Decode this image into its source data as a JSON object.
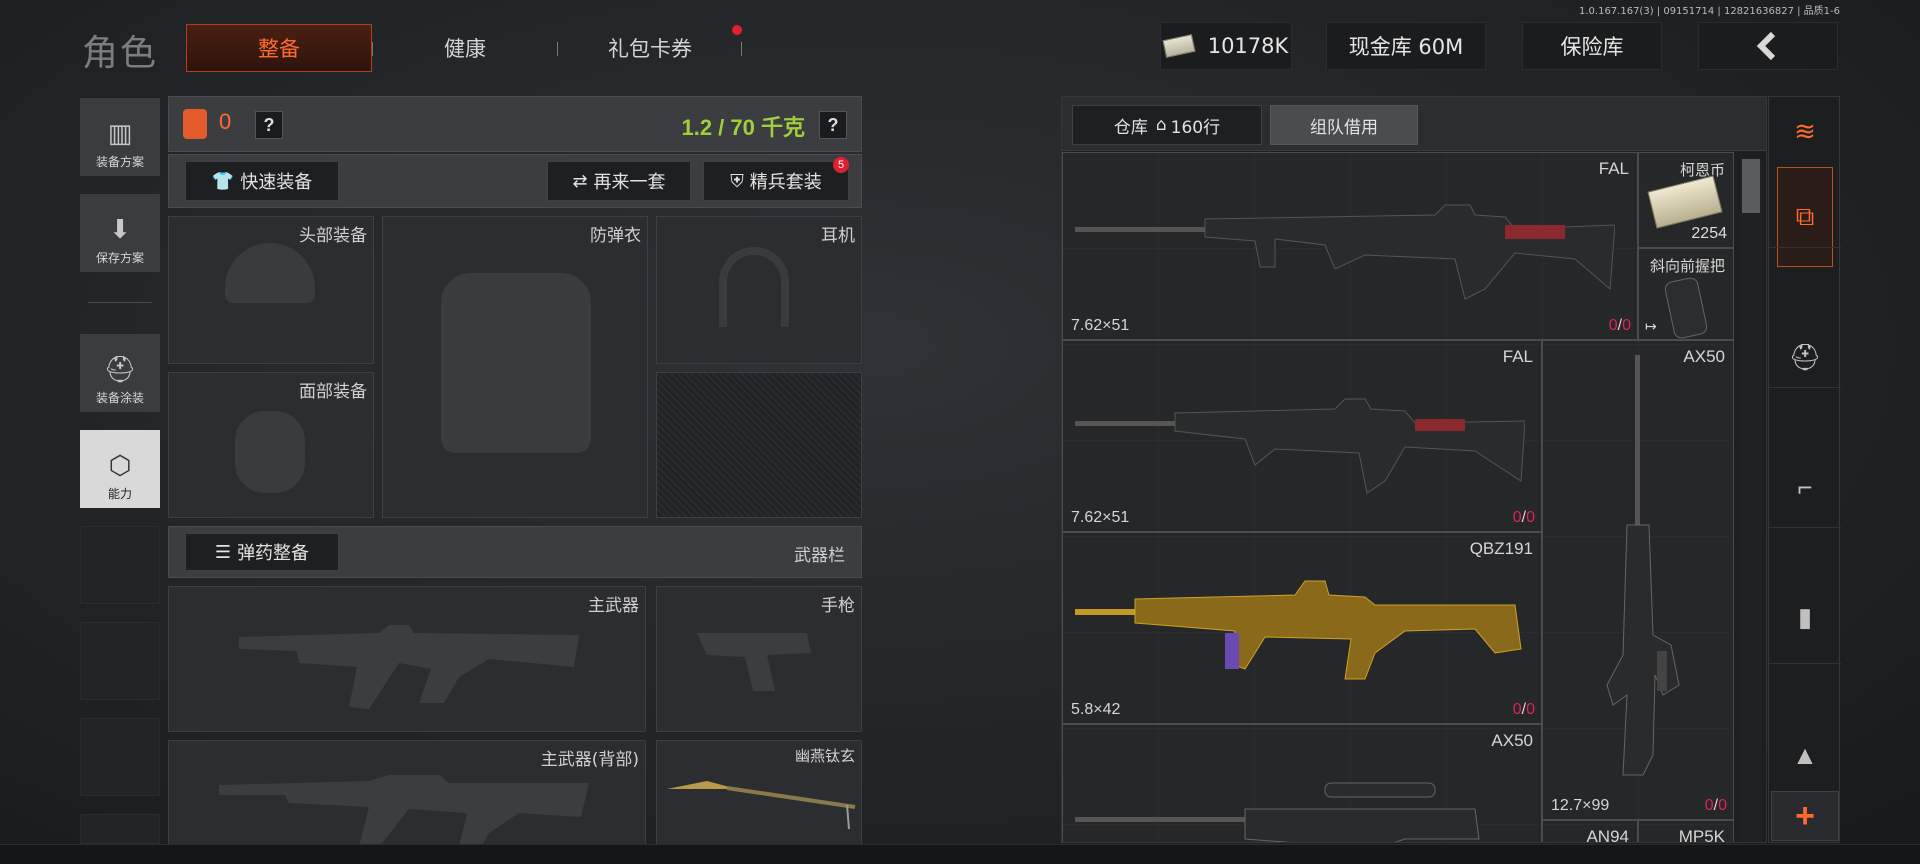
{
  "version": "1.0.167.167(3) | 09151714 | 12821636827 | 品质1-6",
  "nav": {
    "title": "角色",
    "tabs": [
      {
        "label": "整备",
        "active": true
      },
      {
        "label": "健康",
        "active": false
      },
      {
        "label": "礼包卡券",
        "active": false,
        "has_dot": true
      }
    ]
  },
  "topbar": {
    "money": "10178K",
    "cash_vault": "现金库 60M",
    "safe": "保险库",
    "back_icon": "chevron-left-icon"
  },
  "sidebar": [
    {
      "label": "装备方案",
      "icon": "vest-icon"
    },
    {
      "label": "保存方案",
      "icon": "download-icon"
    },
    {
      "label": "装备涂装",
      "icon": "helmet-icon"
    },
    {
      "label": "能力",
      "icon": "lightning-hex-icon",
      "selected": true
    }
  ],
  "loadout": {
    "armor_count": "0",
    "weight": "1.2 / 70 千克",
    "quick_equip": "快速装备",
    "another_set": "再来一套",
    "elite_set": "精兵套装",
    "elite_badge": "5",
    "slots": {
      "head": "头部装备",
      "vest": "防弹衣",
      "earphone": "耳机",
      "face": "面部装备"
    },
    "ammo_equip": "弹药整备",
    "weapon_bar": "武器栏",
    "weapons": {
      "primary": "主武器",
      "pistol": "手枪",
      "primary_back": "主武器(背部)",
      "melee": "幽燕钛玄"
    }
  },
  "warehouse": {
    "tab_label": "仓库",
    "tab_rows": "160行",
    "tab_team": "组队借用",
    "items": [
      {
        "name": "FAL",
        "caliber": "7.62×51",
        "dur_a": "0",
        "dur_b": "0"
      },
      {
        "name": "柯恩币",
        "count": "2254"
      },
      {
        "name": "斜向前握把"
      },
      {
        "name": "FAL",
        "caliber": "7.62×51",
        "dur_a": "0",
        "dur_b": "0"
      },
      {
        "name": "AX50",
        "caliber": "12.7×99",
        "dur_a": "0",
        "dur_b": "0"
      },
      {
        "name": "QBZ191",
        "caliber": "5.8×42",
        "dur_a": "0",
        "dur_b": "0"
      },
      {
        "name": "AX50"
      },
      {
        "name": "AN94"
      },
      {
        "name": "MP5K"
      }
    ]
  },
  "colors": {
    "accent": "#ff6a2e",
    "weight_green": "#9fcf3a",
    "durability_red": "#e0205a"
  }
}
